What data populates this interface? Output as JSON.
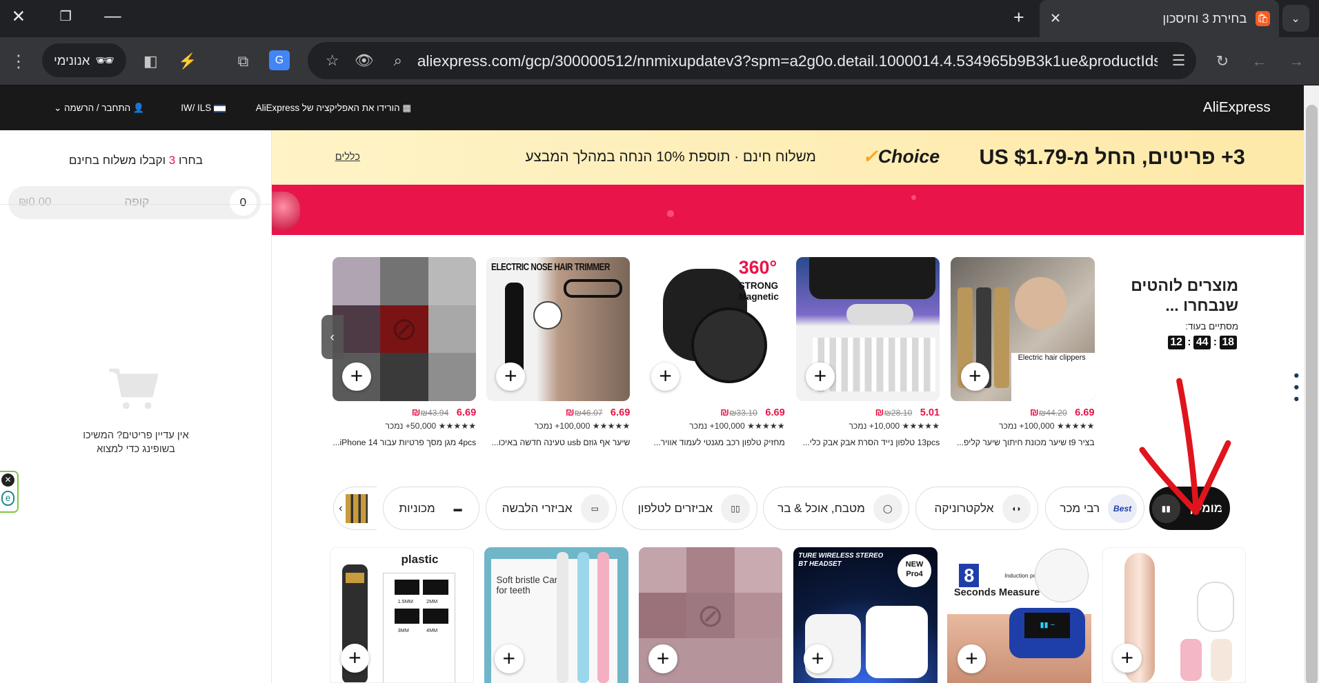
{
  "browser": {
    "tab_title": "בחירת 3 וחיסכון",
    "incognito_label": "אנונימי",
    "url": "aliexpress.com/gcp/300000512/nnmixupdatev3?spm=a2g0o.detail.1000014.4.534965b9B3k1ue&productIds=1005..."
  },
  "site_header": {
    "logo": "AliExpress",
    "app_download": "הורידו את האפליקציה של AliExpress",
    "locale": "IW/ ILS",
    "account": "התחבר / הרשמה"
  },
  "left_panel": {
    "title_prefix": "בחרו ",
    "title_count": "3",
    "title_suffix": " וקבלו משלוח בחינם",
    "cart_count": "0",
    "checkout_label": "קופה",
    "total": "₪0.00",
    "empty_line1": "אין עדיין פריטים? המשיכו",
    "empty_line2": "בשופינג כדי למצוא"
  },
  "promo": {
    "headline": "3+ פריטים, החל מ-US $1.79",
    "choice": "Choice",
    "sub": "משלוח חינם · תוספת 10% הנחה במהלך המבצע",
    "terms": "כללים"
  },
  "hot": {
    "title_line1": "מוצרים לוהטים",
    "title_line2": "שנבחרו ...",
    "ends_in": "מסתיים בעוד:",
    "timer": [
      "12",
      "44",
      "18"
    ]
  },
  "products": [
    {
      "title": "בציר t9 שיער מכונת חיתוך שיער קליפ...",
      "price": "6.69",
      "currency": "₪",
      "old": "₪44.20",
      "sold": "100,000+ נמכר",
      "image_text": "Electric hair clippers"
    },
    {
      "title": "13pcs טלפון נייד הסרת אבק אבק כלי...",
      "price": "5.01",
      "currency": "₪",
      "old": "₪28.10",
      "sold": "10,000+ נמכר",
      "image_text": ""
    },
    {
      "title": "מחזיק טלפון רכב מגנטי לעמוד אוויר...",
      "price": "6.69",
      "currency": "₪",
      "old": "₪33.10",
      "sold": "100,000+ נמכר",
      "image_text": "360°",
      "image_text2": "STRONG Magnetic"
    },
    {
      "title": "שיער אף גוזם usb טעינה חדשה באיכו...",
      "price": "6.69",
      "currency": "₪",
      "old": "₪46.07",
      "sold": "100,000+ נמכר",
      "image_text": "ELECTRIC NOSE HAIR TRIMMER"
    },
    {
      "title": "4pcs מגן מסך פרטיות עבור iPhone 14...",
      "price": "6.69",
      "currency": "₪",
      "old": "₪43.94",
      "sold": "50,000+ נמכר",
      "image_text": ""
    }
  ],
  "stars": "★★★★★",
  "categories": [
    {
      "label": "מומלץ",
      "icon": "recommended-icon"
    },
    {
      "label": "רבי מכר",
      "icon": "best-icon",
      "icon_text": "Best"
    },
    {
      "label": "אלקטרוניקה",
      "icon": "earbuds-icon"
    },
    {
      "label": "מטבח, אוכל & בר",
      "icon": "kitchen-icon"
    },
    {
      "label": "אביזרים לטלפון",
      "icon": "phone-accessory-icon"
    },
    {
      "label": "אביזרי הלבשה",
      "icon": "belt-icon"
    },
    {
      "label": "מכוניות",
      "icon": "car-icon"
    }
  ],
  "grid": [
    {
      "image_text": "plastic",
      "sizes": [
        "1.5MM",
        "2MM",
        "3MM",
        "4MM"
      ]
    },
    {
      "image_text": "Soft bristle Care for teeth"
    },
    {
      "image_text": ""
    },
    {
      "image_text": "TURE WIRELESS STEREO BT HEADSET",
      "badge": "NEW Pro4"
    },
    {
      "image_text": "8",
      "image_text2": "Seconds Measure",
      "image_text3": "Induction port"
    },
    {
      "image_text": ""
    }
  ],
  "colors": {
    "accent": "#e8144a",
    "header": "#191919",
    "banner": "#fde9a8"
  }
}
